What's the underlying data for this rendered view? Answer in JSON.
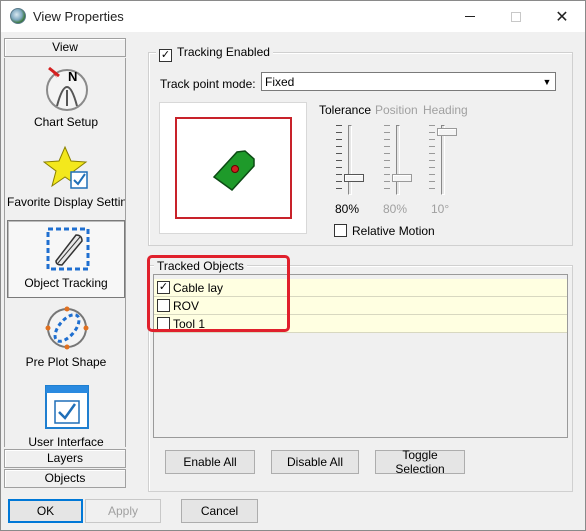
{
  "window": {
    "title": "View Properties"
  },
  "sidebar": {
    "top_header": "View",
    "items": [
      {
        "label": "Chart Setup",
        "icon": "compass-north-icon"
      },
      {
        "label": "Favorite Display Settings",
        "icon": "star-checkbox-icon"
      },
      {
        "label": "Object Tracking",
        "icon": "tracked-vessel-icon"
      },
      {
        "label": "Pre Plot Shape",
        "icon": "preplot-shape-icon"
      },
      {
        "label": "User Interface",
        "icon": "user-interface-icon"
      }
    ],
    "bottom_headers": [
      "Layers",
      "Objects"
    ]
  },
  "tracking": {
    "enabled_label": "Tracking Enabled",
    "enabled": true,
    "mode_label": "Track point mode:",
    "mode_value": "Fixed"
  },
  "sliders": {
    "tolerance": {
      "label": "Tolerance",
      "value": "80%",
      "enabled": true,
      "level": 0.8
    },
    "position": {
      "label": "Position",
      "value": "80%",
      "enabled": false,
      "level": 0.8
    },
    "heading": {
      "label": "Heading",
      "value": "10°",
      "enabled": false,
      "level": 0.1
    }
  },
  "relative_motion": {
    "label": "Relative Motion",
    "checked": false
  },
  "tracked_objects": {
    "title": "Tracked Objects",
    "items": [
      {
        "label": "Cable lay",
        "checked": true
      },
      {
        "label": "ROV",
        "checked": false
      },
      {
        "label": "Tool 1",
        "checked": false
      }
    ],
    "buttons": {
      "enable_all": "Enable All",
      "disable_all": "Disable All",
      "toggle_selection": "Toggle Selection"
    }
  },
  "footer": {
    "ok": "OK",
    "apply": "Apply",
    "cancel": "Cancel"
  },
  "colors": {
    "highlight": "#e0202c",
    "preview_frame": "#c8222a",
    "vessel": "#1e9a2a",
    "list_row_bg": "#ffffe1"
  }
}
